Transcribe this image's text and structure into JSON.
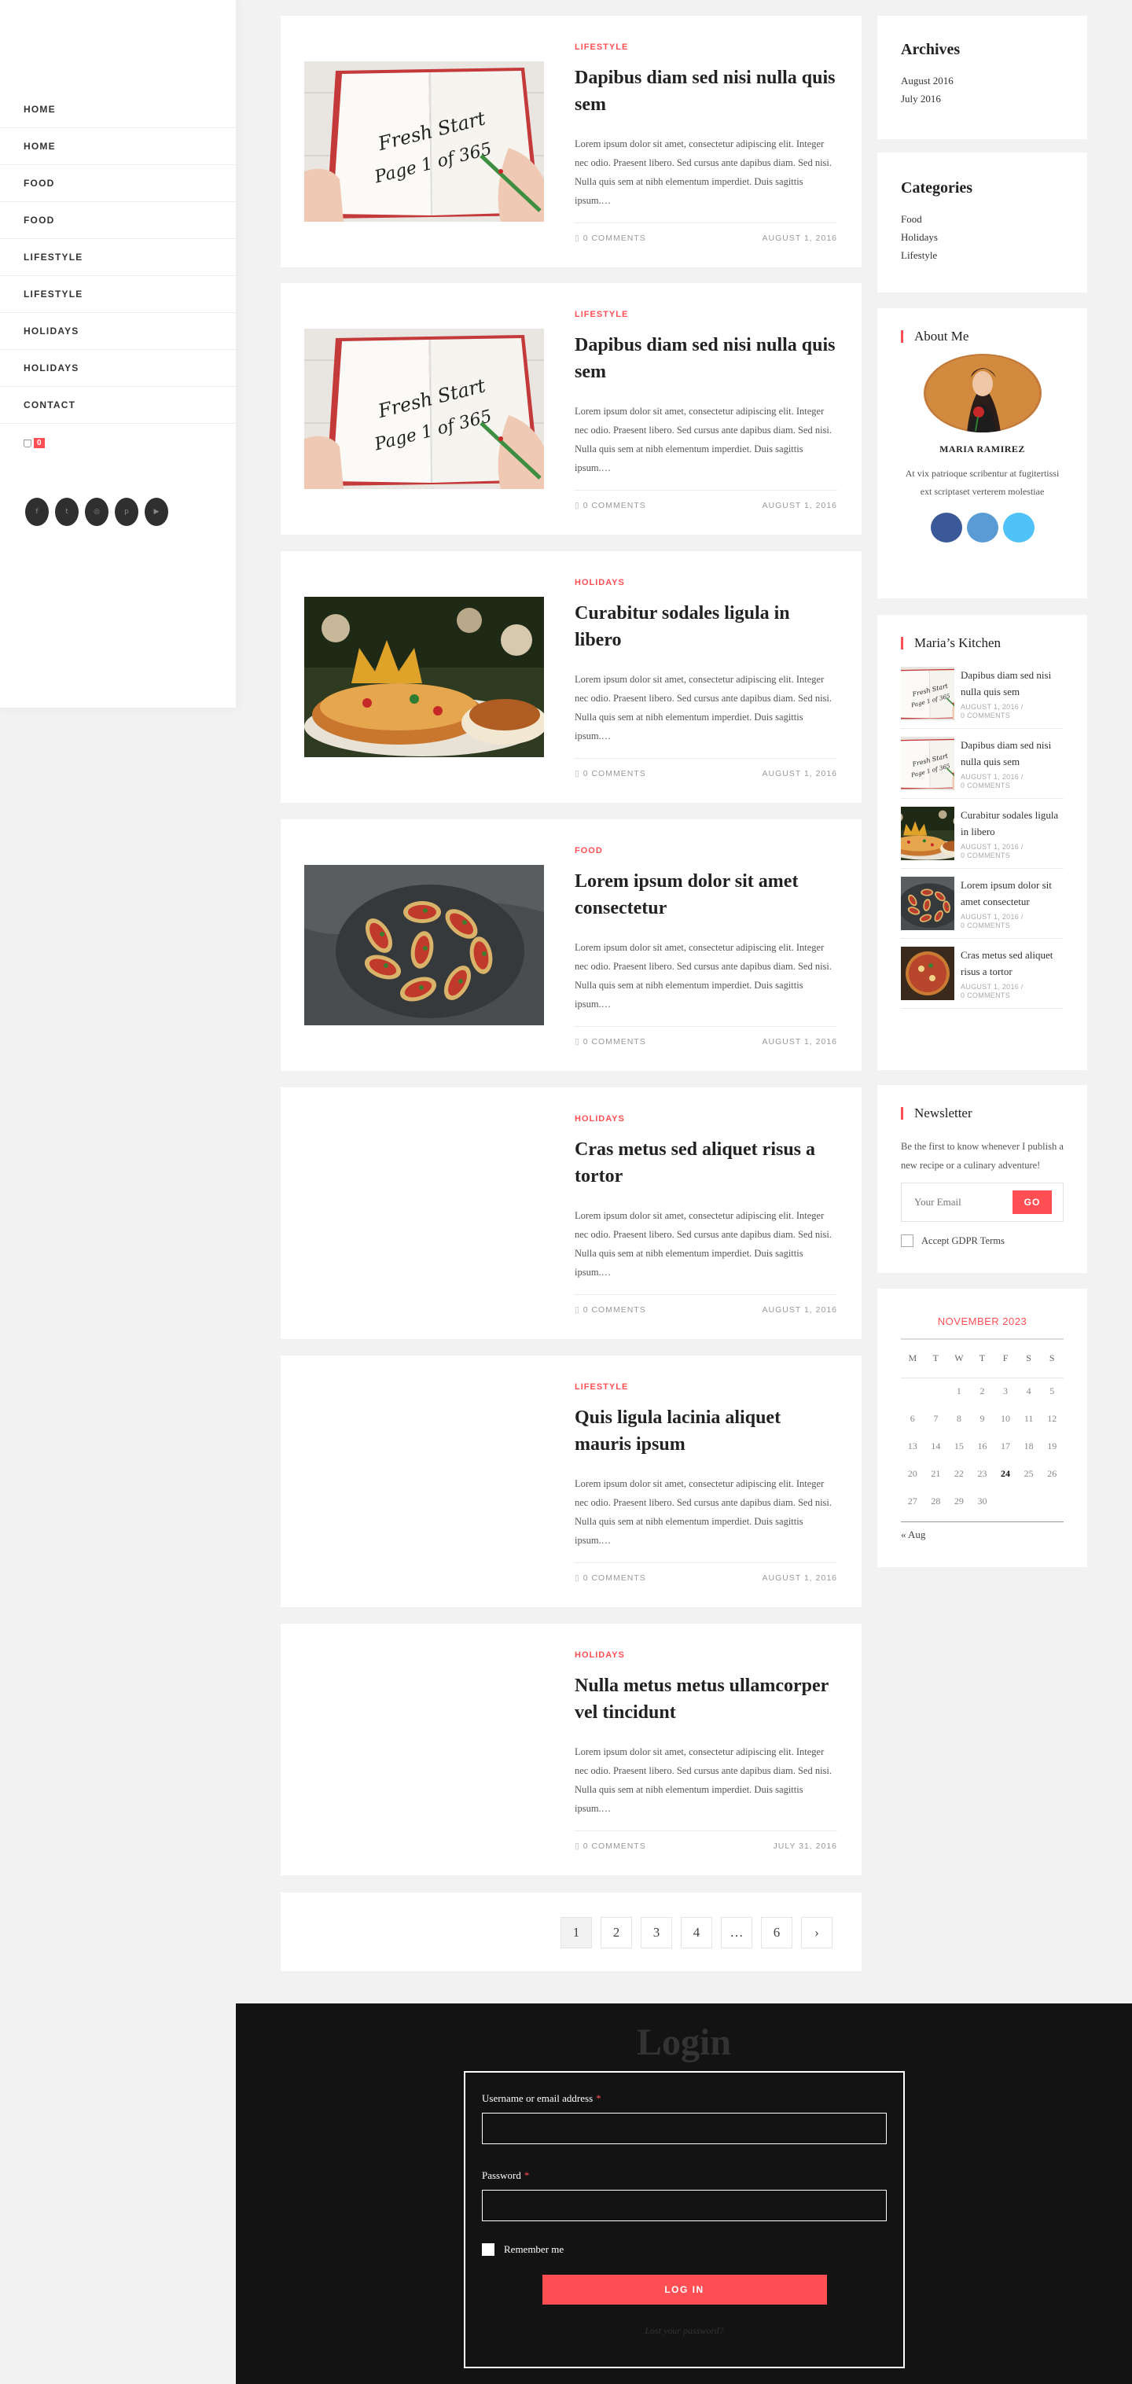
{
  "nav": {
    "items": [
      "HOME",
      "HOME",
      "FOOD",
      "FOOD",
      "LIFESTYLE",
      "LIFESTYLE",
      "HOLIDAYS",
      "HOLIDAYS",
      "CONTACT"
    ],
    "cart_count": "0",
    "social_icons": [
      "facebook-icon",
      "twitter-icon",
      "instagram-icon",
      "pinterest-icon",
      "youtube-icon"
    ]
  },
  "posts": [
    {
      "category": "LIFESTYLE",
      "title": "Dapibus diam sed nisi nulla quis sem",
      "excerpt": "Lorem ipsum dolor sit amet, consectetur adipiscing elit. Integer nec odio. Praesent libero. Sed cursus ante dapibus diam. Sed nisi. Nulla quis sem at nibh elementum imperdiet. Duis sagittis ipsum.…",
      "comments": "0 COMMENTS",
      "date": "AUGUST 1, 2016",
      "image": "notebook"
    },
    {
      "category": "LIFESTYLE",
      "title": "Dapibus diam sed nisi nulla quis sem",
      "excerpt": "Lorem ipsum dolor sit amet, consectetur adipiscing elit. Integer nec odio. Praesent libero. Sed cursus ante dapibus diam. Sed nisi. Nulla quis sem at nibh elementum imperdiet. Duis sagittis ipsum.…",
      "comments": "0 COMMENTS",
      "date": "AUGUST 1, 2016",
      "image": "notebook"
    },
    {
      "category": "HOLIDAYS",
      "title": "Curabitur sodales ligula in libero",
      "excerpt": "Lorem ipsum dolor sit amet, consectetur adipiscing elit. Integer nec odio. Praesent libero. Sed cursus ante dapibus diam. Sed nisi. Nulla quis sem at nibh elementum imperdiet. Duis sagittis ipsum.…",
      "comments": "0 COMMENTS",
      "date": "AUGUST 1, 2016",
      "image": "cake"
    },
    {
      "category": "FOOD",
      "title": "Lorem ipsum dolor sit amet consectetur",
      "excerpt": "Lorem ipsum dolor sit amet, consectetur adipiscing elit. Integer nec odio. Praesent libero. Sed cursus ante dapibus diam. Sed nisi. Nulla quis sem at nibh elementum imperdiet. Duis sagittis ipsum.…",
      "comments": "0 COMMENTS",
      "date": "AUGUST 1, 2016",
      "image": "bruschetta"
    },
    {
      "category": "HOLIDAYS",
      "title": "Cras metus sed aliquet risus a tortor",
      "excerpt": "Lorem ipsum dolor sit amet, consectetur adipiscing elit. Integer nec odio. Praesent libero. Sed cursus ante dapibus diam. Sed nisi. Nulla quis sem at nibh elementum imperdiet. Duis sagittis ipsum.…",
      "comments": "0 COMMENTS",
      "date": "AUGUST 1, 2016",
      "image": ""
    },
    {
      "category": "LIFESTYLE",
      "title": "Quis ligula lacinia aliquet mauris ipsum",
      "excerpt": "Lorem ipsum dolor sit amet, consectetur adipiscing elit. Integer nec odio. Praesent libero. Sed cursus ante dapibus diam. Sed nisi. Nulla quis sem at nibh elementum imperdiet. Duis sagittis ipsum.…",
      "comments": "0 COMMENTS",
      "date": "AUGUST 1, 2016",
      "image": ""
    },
    {
      "category": "HOLIDAYS",
      "title": "Nulla metus metus ullamcorper vel tincidunt",
      "excerpt": "Lorem ipsum dolor sit amet, consectetur adipiscing elit. Integer nec odio. Praesent libero. Sed cursus ante dapibus diam. Sed nisi. Nulla quis sem at nibh elementum imperdiet. Duis sagittis ipsum.…",
      "comments": "0 COMMENTS",
      "date": "JULY 31, 2016",
      "image": ""
    }
  ],
  "pagination": {
    "pages": [
      "1",
      "2",
      "3",
      "4",
      "…",
      "6"
    ],
    "current": "1",
    "next_icon": "chevron-right-icon"
  },
  "archives": {
    "title": "Archives",
    "items": [
      "August 2016",
      "July 2016"
    ]
  },
  "categories": {
    "title": "Categories",
    "items": [
      "Food",
      "Holidays",
      "Lifestyle"
    ]
  },
  "about": {
    "title": "About Me",
    "name": "MARIA RAMIREZ",
    "text": "At vix patrioque scribentur at fugitertissi ext scriptaset verterem molestiae",
    "social_icons": [
      "facebook-icon",
      "twitter-icon",
      "vimeo-icon"
    ],
    "social_colors": [
      "#3b5998",
      "#5b9bd5",
      "#4fc3f7"
    ]
  },
  "kitchen": {
    "title": "Maria’s Kitchen",
    "items": [
      {
        "title": "Dapibus diam sed nisi nulla quis sem",
        "date": "AUGUST 1, 2016 /",
        "comments": "0 COMMENTS",
        "image": "notebook"
      },
      {
        "title": "Dapibus diam sed nisi nulla quis sem",
        "date": "AUGUST 1, 2016 /",
        "comments": "0 COMMENTS",
        "image": "notebook"
      },
      {
        "title": "Curabitur sodales ligula in libero",
        "date": "AUGUST 1, 2016 /",
        "comments": "0 COMMENTS",
        "image": "cake"
      },
      {
        "title": "Lorem ipsum dolor sit amet consectetur",
        "date": "AUGUST 1, 2016 /",
        "comments": "0 COMMENTS",
        "image": "bruschetta"
      },
      {
        "title": "Cras metus sed aliquet risus a tortor",
        "date": "AUGUST 1, 2016 /",
        "comments": "0 COMMENTS",
        "image": "pizza"
      }
    ]
  },
  "newsletter": {
    "title": "Newsletter",
    "text": "Be the first to know whenever I publish a new recipe or a culinary adventure!",
    "placeholder": "Your Email",
    "button": "GO",
    "gdpr": "Accept GDPR Terms"
  },
  "calendar": {
    "caption": "NOVEMBER 2023",
    "days": [
      "M",
      "T",
      "W",
      "T",
      "F",
      "S",
      "S"
    ],
    "weeks": [
      [
        "",
        "",
        "1",
        "2",
        "3",
        "4",
        "5"
      ],
      [
        "6",
        "7",
        "8",
        "9",
        "10",
        "11",
        "12"
      ],
      [
        "13",
        "14",
        "15",
        "16",
        "17",
        "18",
        "19"
      ],
      [
        "20",
        "21",
        "22",
        "23",
        "24",
        "25",
        "26"
      ],
      [
        "27",
        "28",
        "29",
        "30",
        "",
        "",
        ""
      ]
    ],
    "today": "24",
    "prev": "« Aug"
  },
  "login": {
    "title": "Login",
    "username_label": "Username or email address",
    "required_mark": "*",
    "password_label": "Password",
    "remember": "Remember me",
    "button": "LOG IN",
    "lost": "Lost your password?"
  },
  "colors": {
    "accent": "#ff4f55",
    "footer_bg": "#131313",
    "page_bg": "#f2f2f2"
  }
}
